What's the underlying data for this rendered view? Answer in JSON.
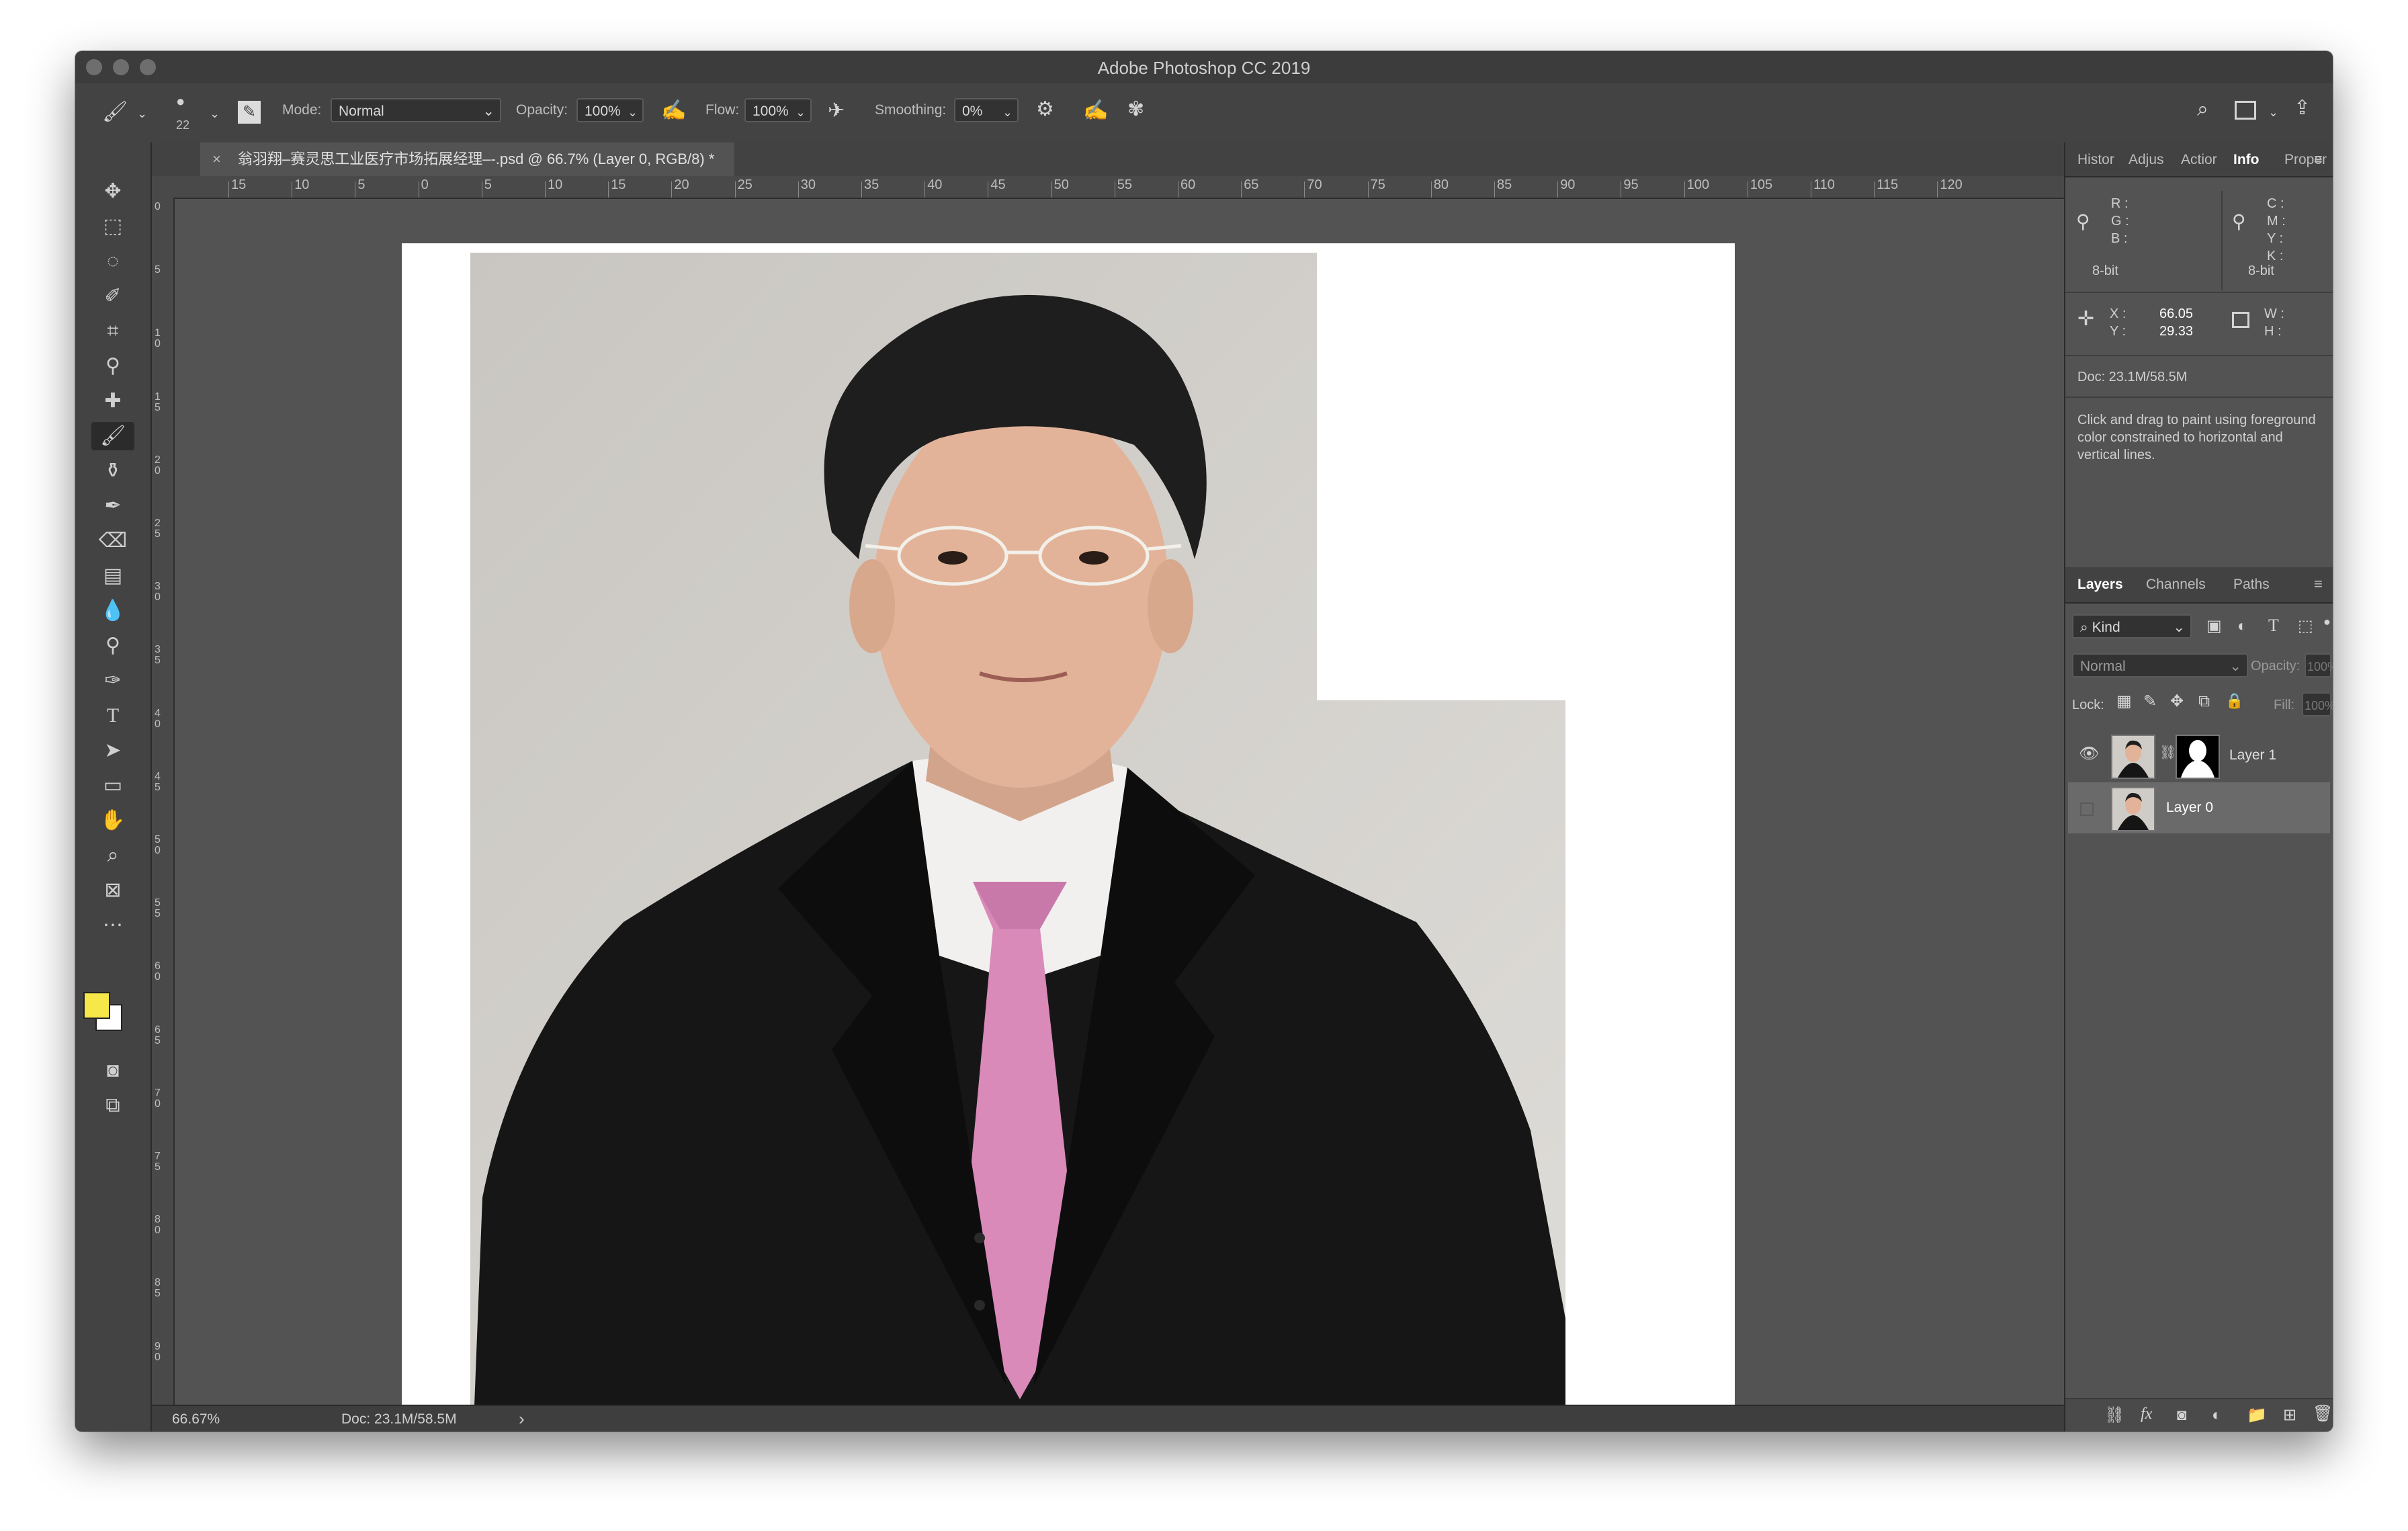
{
  "app": {
    "title": "Adobe Photoshop CC 2019"
  },
  "options_bar": {
    "brush_size": "22",
    "mode_label": "Mode:",
    "mode_value": "Normal",
    "opacity_label": "Opacity:",
    "opacity_value": "100%",
    "flow_label": "Flow:",
    "flow_value": "100%",
    "smoothing_label": "Smoothing:",
    "smoothing_value": "0%"
  },
  "document": {
    "tab_title": "翁羽翔–赛灵思工业医疗市场拓展经理–-.psd @ 66.7% (Layer 0, RGB/8) *"
  },
  "rulers": {
    "h_ticks": [
      "15",
      "10",
      "5",
      "0",
      "5",
      "10",
      "15",
      "20",
      "25",
      "30",
      "35",
      "40",
      "45",
      "50",
      "55",
      "60",
      "65",
      "70",
      "75",
      "80",
      "85",
      "90",
      "95",
      "100",
      "105",
      "110",
      "115",
      "120"
    ],
    "v_ticks": [
      "0",
      "5",
      "10",
      "15",
      "20",
      "25",
      "30",
      "35",
      "40",
      "45",
      "50",
      "55",
      "60",
      "65",
      "70",
      "75",
      "80",
      "85",
      "90"
    ]
  },
  "status": {
    "zoom": "66.67%",
    "doc": "Doc: 23.1M/58.5M",
    "arrow": "›"
  },
  "panel_top": {
    "tabs": [
      "Histor",
      "Adjus",
      "Actior",
      "Info",
      "Proper"
    ],
    "active_tab": "Info",
    "rgb_labels": [
      "R :",
      "G :",
      "B :"
    ],
    "cmyk_labels": [
      "C :",
      "M :",
      "Y :",
      "K :"
    ],
    "bit_left": "8-bit",
    "bit_right": "8-bit",
    "x_label": "X :",
    "y_label": "Y :",
    "x_value": "66.05",
    "y_value": "29.33",
    "w_label": "W :",
    "h_label": "H :",
    "doc": "Doc: 23.1M/58.5M",
    "hint": "Click and drag to paint using foreground color constrained to horizontal and vertical lines."
  },
  "layers_panel": {
    "tabs": [
      "Layers",
      "Channels",
      "Paths"
    ],
    "active_tab": "Layers",
    "kind_label": "Kind",
    "blend_mode": "Normal",
    "opacity_label": "Opacity:",
    "opacity_value": "100%",
    "lock_label": "Lock:",
    "fill_label": "Fill:",
    "fill_value": "100%",
    "layers": [
      {
        "name": "Layer 1",
        "visible": true,
        "selected": false,
        "has_mask": true
      },
      {
        "name": "Layer 0",
        "visible": false,
        "selected": true,
        "has_mask": false
      }
    ]
  },
  "colors": {
    "foreground": "#f7e84a",
    "background": "#ffffff"
  }
}
